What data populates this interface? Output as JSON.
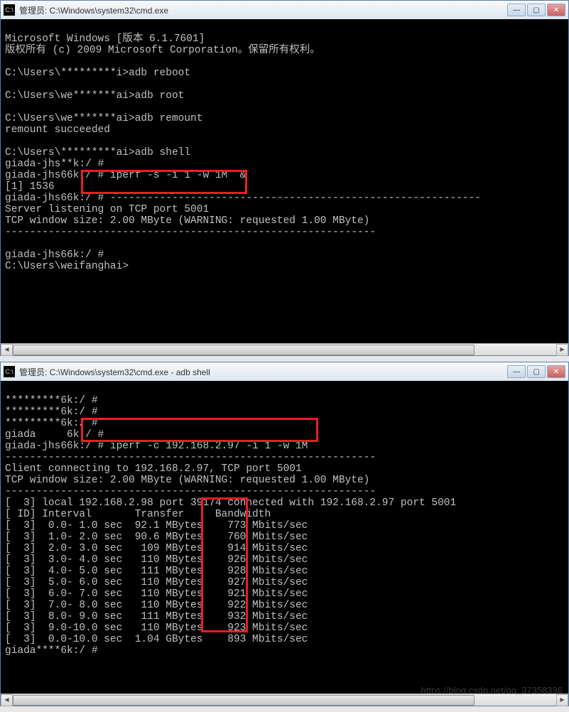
{
  "window1": {
    "title": "管理员: C:\\Windows\\system32\\cmd.exe",
    "lines": {
      "l1": "Microsoft Windows [版本 6.1.7601]",
      "l2": "版权所有 (c) 2009 Microsoft Corporation。保留所有权利。",
      "l3": "C:\\Users\\*********i>adb reboot",
      "l4": "C:\\Users\\we*******ai>adb root",
      "l5": "C:\\Users\\we*******ai>adb remount",
      "l6": "remount succeeded",
      "l7": "C:\\Users\\*********ai>adb shell",
      "l8": "giada-jhs**k:/ #",
      "l9_prefix": "giada-jhs66k:/",
      "l9_cmd": " # iperf -s -i 1 -w 1M  & ",
      "l10": "[1] 1536",
      "l11": "giada-jhs66k:/ # ------------------------------------------------------------",
      "l12": "Server listening on TCP port 5001",
      "l13": "TCP window size: 2.00 MByte (WARNING: requested 1.00 MByte)",
      "l14": "------------------------------------------------------------",
      "l15": "giada-jhs66k:/ #",
      "l16": "C:\\Users\\weifanghai>"
    }
  },
  "window2": {
    "title": "管理员: C:\\Windows\\system32\\cmd.exe - adb  shell",
    "lines": {
      "p0": "      ",
      "p1": "*********6k:/ #",
      "p2": "*********6k:/ #",
      "p3": "*********6k:/ #",
      "p4": "giada     6k:/ #",
      "p5_prefix": "giada-jhs66k:/",
      "p5_cmd": " # iperf -c 192.168.2.97 -i 1 -w 1M ",
      "c1": "------------------------------------------------------------",
      "c2": "Client connecting to 192.168.2.97, TCP port 5001",
      "c3": "TCP window size: 2.00 MByte (WARNING: requested 1.00 MByte)",
      "c4": "------------------------------------------------------------",
      "c5": "[  3] local 192.168.2.98 port 39174 connected with 192.168.2.97 port 5001",
      "hdr": "[ ID] Interval       Transfer     Bandwidth",
      "tail": "giada****6k:/ #"
    },
    "results": [
      {
        "id": "[  3]",
        "interval": " 0.0- 1.0 sec",
        "transfer": "92.1 MBytes",
        "bw": "  773 Mbits/sec"
      },
      {
        "id": "[  3]",
        "interval": " 1.0- 2.0 sec",
        "transfer": "90.6 MBytes",
        "bw": "  760 Mbits/sec"
      },
      {
        "id": "[  3]",
        "interval": " 2.0- 3.0 sec",
        "transfer": " 109 MBytes",
        "bw": "  914 Mbits/sec"
      },
      {
        "id": "[  3]",
        "interval": " 3.0- 4.0 sec",
        "transfer": " 110 MBytes",
        "bw": "  926 Mbits/sec"
      },
      {
        "id": "[  3]",
        "interval": " 4.0- 5.0 sec",
        "transfer": " 111 MBytes",
        "bw": "  928 Mbits/sec"
      },
      {
        "id": "[  3]",
        "interval": " 5.0- 6.0 sec",
        "transfer": " 110 MBytes",
        "bw": "  927 Mbits/sec"
      },
      {
        "id": "[  3]",
        "interval": " 6.0- 7.0 sec",
        "transfer": " 110 MBytes",
        "bw": "  921 Mbits/sec"
      },
      {
        "id": "[  3]",
        "interval": " 7.0- 8.0 sec",
        "transfer": " 110 MBytes",
        "bw": "  922 Mbits/sec"
      },
      {
        "id": "[  3]",
        "interval": " 8.0- 9.0 sec",
        "transfer": " 111 MBytes",
        "bw": "  932 Mbits/sec"
      },
      {
        "id": "[  3]",
        "interval": " 9.0-10.0 sec",
        "transfer": " 110 MBytes",
        "bw": "  923 Mbits/sec"
      },
      {
        "id": "[  3]",
        "interval": " 0.0-10.0 sec",
        "transfer": "1.04 GBytes",
        "bw": "  893 Mbits/sec"
      }
    ]
  },
  "watermark": "https://blog.csdn.net/qq_37358336",
  "icons": {
    "cmd": "C:\\",
    "min": "—",
    "max": "▢",
    "close": "✕",
    "left": "◀",
    "right": "▶"
  }
}
